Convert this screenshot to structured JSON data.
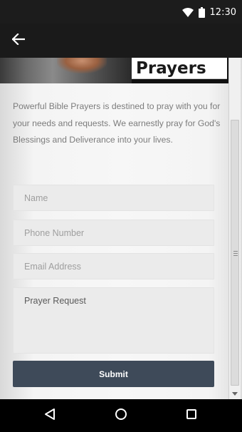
{
  "status_bar": {
    "time": "12:30",
    "icons": [
      "wifi-icon",
      "battery-icon"
    ]
  },
  "app_bar": {
    "back_icon": "arrow-left-icon"
  },
  "banner": {
    "label": "Prayers"
  },
  "intro_text": "Powerful Bible Prayers is destined to pray with you for your needs and requests. We earnestly pray for God's Blessings and Deliverance into your lives.",
  "form": {
    "name": {
      "placeholder": "Name",
      "value": ""
    },
    "phone": {
      "placeholder": "Phone Number",
      "value": ""
    },
    "email": {
      "placeholder": "Email Address",
      "value": ""
    },
    "prayer_request": {
      "placeholder": "Prayer Request",
      "value": ""
    },
    "submit_label": "Submit"
  },
  "nav_bar": {
    "icons": [
      "back-triangle-icon",
      "home-circle-icon",
      "recents-square-icon"
    ]
  },
  "colors": {
    "app_bar": "#1a1a1a",
    "submit_button": "#3e4a59",
    "field_background": "#ebebeb",
    "intro_text": "#7c7c7c"
  }
}
